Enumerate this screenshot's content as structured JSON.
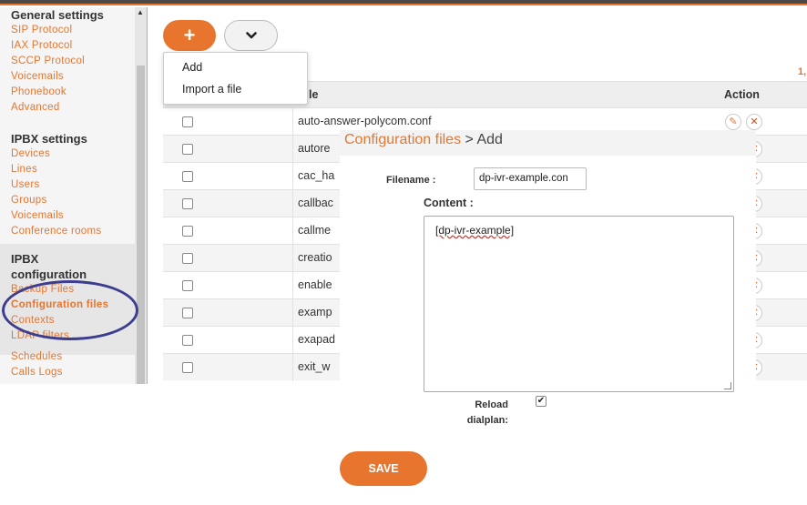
{
  "sidebar": {
    "general": {
      "title": "General settings",
      "items": [
        "SIP Protocol",
        "IAX Protocol",
        "SCCP Protocol",
        "Voicemails",
        "Phonebook",
        "Advanced"
      ]
    },
    "ipbx_settings": {
      "title": "IPBX settings",
      "items": [
        "Devices",
        "Lines",
        "Users",
        "Groups",
        "Voicemails",
        "Conference rooms"
      ]
    },
    "ipbx_configuration": {
      "title": "IPBX configuration",
      "items": [
        "Backup Files",
        "Configuration files",
        "Contexts",
        "LDAP filters",
        "Schedules",
        "Calls Logs"
      ]
    }
  },
  "toolbar": {
    "add_icon": "+",
    "more_icon": "chevron-down-icon",
    "more_glyph": "⌄"
  },
  "dropdown": {
    "items": [
      "Add",
      "Import a file"
    ]
  },
  "pager": "1,",
  "table": {
    "headers": {
      "name": "le",
      "action": "Action"
    },
    "rows": [
      "auto-answer-polycom.conf",
      "autore",
      "cac_ha",
      "callbac",
      "callme",
      "creatio",
      "enable",
      "examp",
      "exapad",
      "exit_w"
    ]
  },
  "modal": {
    "breadcrumb": "Configuration files",
    "separator": ">",
    "title": "Add",
    "filename_label": "Filename :",
    "filename_value": "dp-ivr-example.con",
    "content_label": "Content :",
    "content_value": "[dp-ivr-example]"
  },
  "reload": {
    "label_line1": "Reload",
    "label_line2": "dialplan:",
    "checked": "✔"
  },
  "save_label": "SAVE",
  "colors": {
    "accent": "#e8752e",
    "annotation": "#3d3d8f"
  }
}
